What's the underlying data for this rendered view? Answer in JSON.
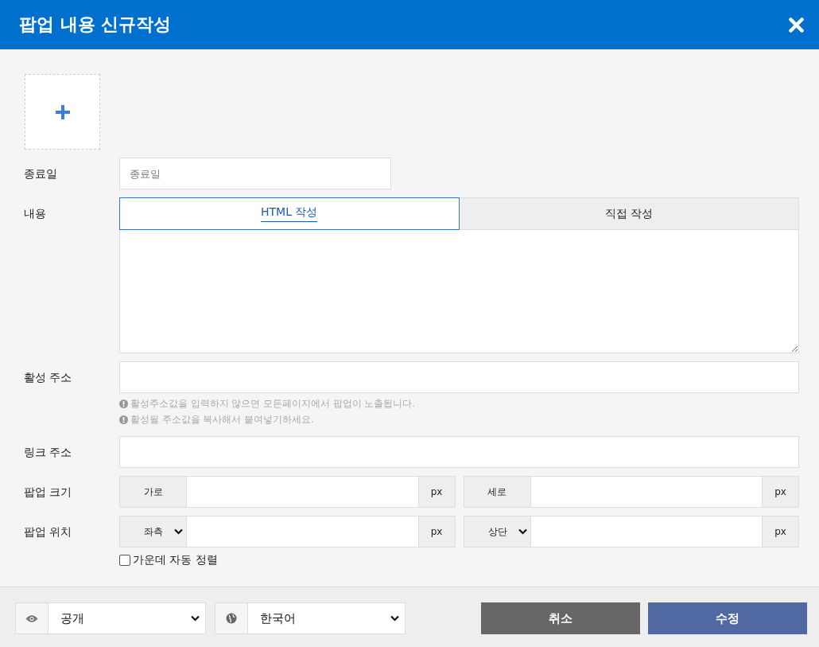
{
  "dialog": {
    "title": "팝업 내용 신규작성"
  },
  "form": [
    {
      "kind": "text",
      "label": "종료일",
      "placeholder": "종료일"
    },
    {
      "kind": "editor",
      "label": "내용",
      "tabs": [
        {
          "label": "HTML 작성",
          "selected": true
        },
        {
          "label": "직접 작성",
          "selected": false
        }
      ]
    },
    {
      "kind": "text",
      "label": "활성 주소",
      "hints": [
        "활성주소값을 입력하지 않으면 모든페이지에서 팝업이 노출됩니다.",
        "활성될 주소값을 복사해서 붙여넣기하세요."
      ]
    },
    {
      "kind": "text",
      "label": "링크 주소"
    },
    {
      "kind": "pair",
      "label": "팝업 크기",
      "parts": [
        {
          "kind": "label",
          "prefix": "가로",
          "unit": "px"
        },
        {
          "kind": "label",
          "prefix": "세로",
          "unit": "px"
        }
      ]
    },
    {
      "kind": "pair",
      "label": "팝업 위치",
      "parts": [
        {
          "kind": "select",
          "prefix": "좌측",
          "unit": "px"
        },
        {
          "kind": "select",
          "prefix": "상단",
          "unit": "px"
        }
      ]
    }
  ],
  "auto_center": {
    "label": "가운데 자동 정렬",
    "checked": false
  },
  "footer": {
    "selects": [
      {
        "kind": "visibility",
        "value": "공개"
      },
      {
        "kind": "language",
        "value": "한국어"
      }
    ],
    "buttons": [
      {
        "kind": "cancel",
        "label": "취소"
      },
      {
        "kind": "primary",
        "label": "수정"
      }
    ]
  }
}
